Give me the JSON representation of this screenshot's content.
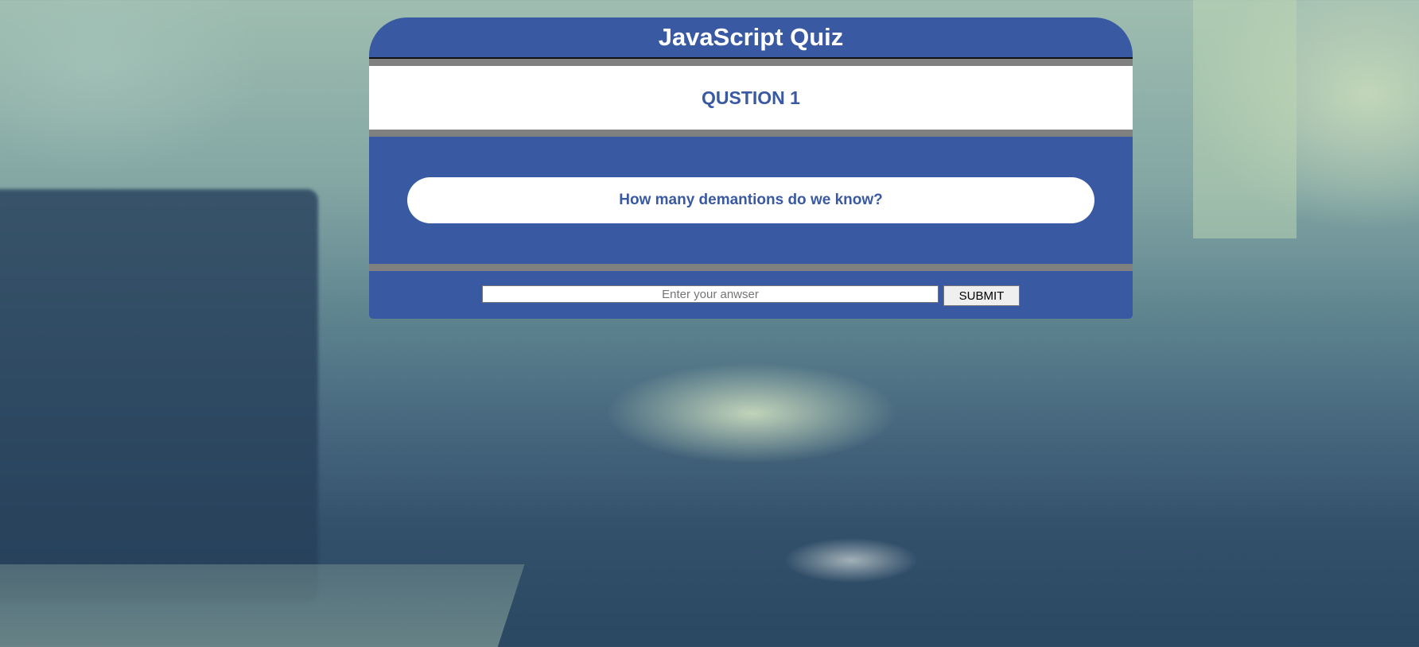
{
  "quiz": {
    "title": "JavaScript Quiz",
    "question_number": "QUSTION 1",
    "question_text": "How many demantions do we know?",
    "answer_placeholder": "Enter your anwser",
    "answer_value": "",
    "submit_label": "SUBMIT"
  },
  "colors": {
    "primary": "#3959a3",
    "divider": "#808080",
    "panel_light": "#ffffff"
  }
}
